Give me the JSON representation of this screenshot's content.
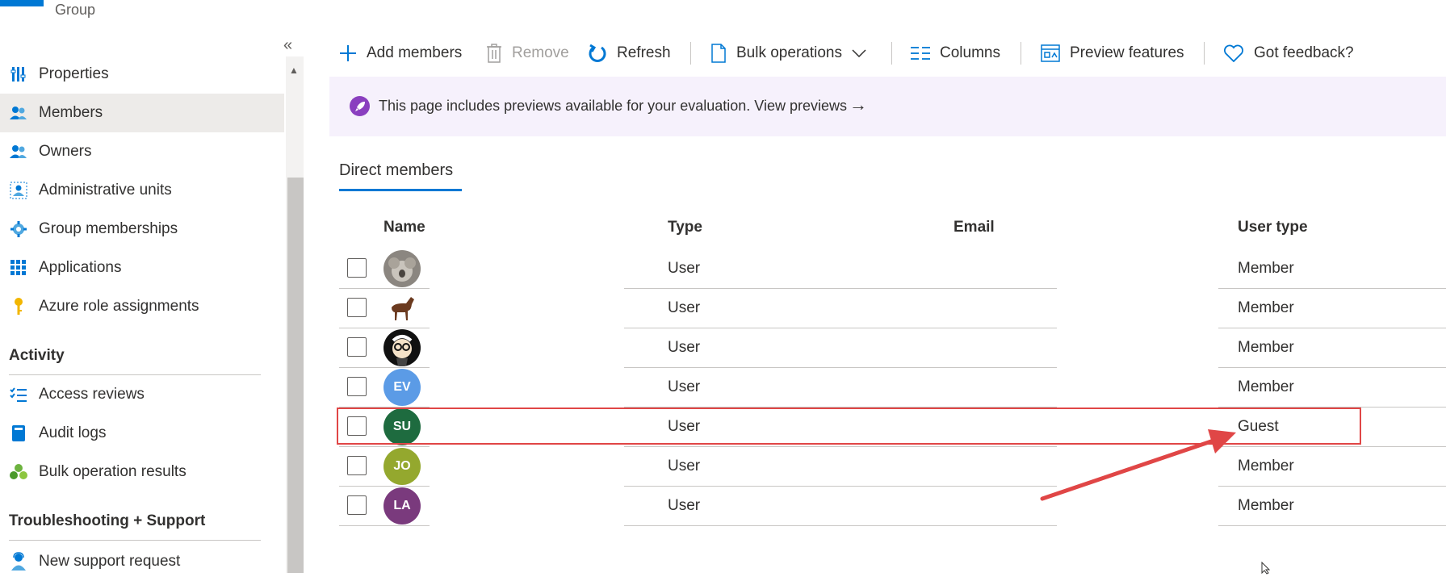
{
  "header": {
    "group_label": "Group"
  },
  "nav": {
    "collapse_glyph": "«",
    "items": [
      {
        "label": "Properties",
        "icon": "properties-icon"
      },
      {
        "label": "Members",
        "icon": "members-icon",
        "selected": true
      },
      {
        "label": "Owners",
        "icon": "owners-icon"
      },
      {
        "label": "Administrative units",
        "icon": "admin-units-icon"
      },
      {
        "label": "Group memberships",
        "icon": "group-memberships-icon"
      },
      {
        "label": "Applications",
        "icon": "applications-icon"
      },
      {
        "label": "Azure role assignments",
        "icon": "key-icon"
      }
    ],
    "activity": {
      "heading": "Activity",
      "items": [
        {
          "label": "Access reviews",
          "icon": "access-reviews-icon"
        },
        {
          "label": "Audit logs",
          "icon": "audit-logs-icon"
        },
        {
          "label": "Bulk operation results",
          "icon": "bulk-results-icon"
        }
      ]
    },
    "troubleshooting": {
      "heading": "Troubleshooting + Support",
      "items": [
        {
          "label": "New support request",
          "icon": "support-request-icon"
        }
      ]
    }
  },
  "toolbar": {
    "add_members": "Add members",
    "remove": "Remove",
    "refresh": "Refresh",
    "bulk_operations": "Bulk operations",
    "columns": "Columns",
    "preview_features": "Preview features",
    "feedback": "Got feedback?"
  },
  "banner": {
    "text": "This page includes previews available for your evaluation.",
    "link": "View previews",
    "arrow": "→"
  },
  "tabs": {
    "direct_members": "Direct members"
  },
  "table": {
    "columns": {
      "name": "Name",
      "type": "Type",
      "email": "Email",
      "user_type": "User type"
    },
    "rows": [
      {
        "initials": "",
        "avatar": "photo-koala",
        "type": "User",
        "email": "",
        "user_type": "Member"
      },
      {
        "initials": "",
        "avatar": "photo-horse",
        "type": "User",
        "email": "",
        "user_type": "Member"
      },
      {
        "initials": "",
        "avatar": "photo-cartoon",
        "type": "User",
        "email": "",
        "user_type": "Member"
      },
      {
        "initials": "EV",
        "avatar": "initials",
        "color": "#5b9be6",
        "type": "User",
        "email": "",
        "user_type": "Member"
      },
      {
        "initials": "SU",
        "avatar": "initials",
        "color": "#1e6b3f",
        "type": "User",
        "email": "",
        "user_type": "Guest",
        "highlighted": true
      },
      {
        "initials": "JO",
        "avatar": "initials",
        "color": "#94a82e",
        "type": "User",
        "email": "",
        "user_type": "Member"
      },
      {
        "initials": "LA",
        "avatar": "initials",
        "color": "#7a3a7d",
        "type": "User",
        "email": "",
        "user_type": "Member"
      }
    ]
  },
  "colors": {
    "accent": "#0078d4",
    "annotation": "#e04646",
    "banner_bg": "#f6f1fc",
    "selected_nav": "#edebe9"
  }
}
